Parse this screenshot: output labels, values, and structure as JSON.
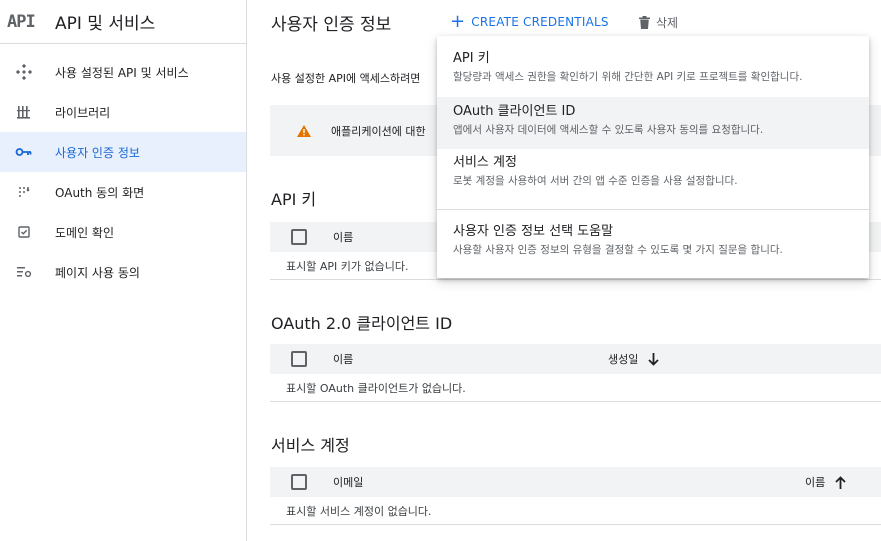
{
  "brand": {
    "logo_text": "API",
    "title": "API 및 서비스"
  },
  "sidebar": {
    "items": [
      {
        "label": "사용 설정된 API 및 서비스",
        "icon": "diamond-grid-icon",
        "active": false
      },
      {
        "label": "라이브러리",
        "icon": "library-icon",
        "active": false
      },
      {
        "label": "사용자 인증 정보",
        "icon": "key-icon",
        "active": true
      },
      {
        "label": "OAuth 동의 화면",
        "icon": "dots-grid-icon",
        "active": false
      },
      {
        "label": "도메인 확인",
        "icon": "checkbox-icon",
        "active": false
      },
      {
        "label": "페이지 사용 동의",
        "icon": "list-settings-icon",
        "active": false
      }
    ]
  },
  "header": {
    "title": "사용자 인증 정보",
    "create_label": "CREATE CREDENTIALS",
    "delete_label": "삭제"
  },
  "intro_text": "사용 설정한 API에 액세스하려면",
  "banner_text": "애플리케이션에 대한",
  "sections": {
    "api_keys": {
      "title": "API 키",
      "col_name": "이름",
      "empty": "표시할 API 키가 없습니다."
    },
    "oauth": {
      "title": "OAuth 2.0 클라이언트 ID",
      "col_name": "이름",
      "col_created": "생성일",
      "empty": "표시할 OAuth 클라이언트가 없습니다."
    },
    "service": {
      "title": "서비스 계정",
      "col_email": "이메일",
      "col_name": "이름",
      "empty": "표시할 서비스 계정이 없습니다."
    }
  },
  "menu": {
    "items": [
      {
        "label": "API 키",
        "desc": "할당량과 액세스 권한을 확인하기 위해 간단한 API 키로 프로젝트를 확인합니다."
      },
      {
        "label": "OAuth 클라이언트 ID",
        "desc": "앱에서 사용자 데이터에 액세스할 수 있도록 사용자 동의를 요청합니다."
      },
      {
        "label": "서비스 계정",
        "desc": "로봇 계정을 사용하여 서버 간의 앱 수준 인증을 사용 설정합니다."
      },
      {
        "label": "사용자 인증 정보 선택 도움말",
        "desc": "사용할 사용자 인증 정보의 유형을 결정할 수 있도록 몇 가지 질문을 합니다."
      }
    ]
  },
  "colors": {
    "accent": "#1a73e8",
    "active_bg": "#e8f0fe",
    "warning": "#e37400",
    "header_bg": "#f1f3f4"
  }
}
